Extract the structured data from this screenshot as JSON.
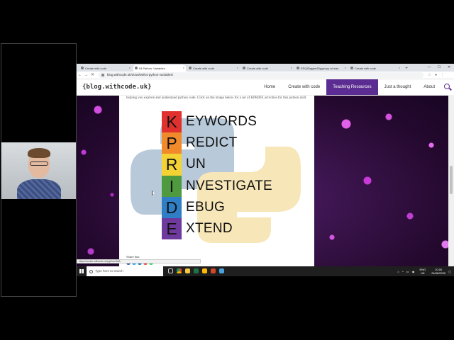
{
  "browser": {
    "tabs": [
      {
        "label": "Create with code",
        "active": false
      },
      {
        "label": "04 Python: Variables",
        "active": true
      },
      {
        "label": "Create with code",
        "active": false
      },
      {
        "label": "Create with code",
        "active": false
      },
      {
        "label": "EPQ/Diggen/Digger.py at mas",
        "active": false
      },
      {
        "label": "Create with code",
        "active": false
      }
    ],
    "url": "blog.withcode.uk/2018/08/04-python-variables/",
    "status_url": "https://create.withcode.uk/python/A8A"
  },
  "site": {
    "logo": "{blog.withcode.uk}",
    "nav": [
      {
        "label": "Home",
        "active": false
      },
      {
        "label": "Create with code",
        "active": false
      },
      {
        "label": "Teaching Resources",
        "active": true
      },
      {
        "label": "Just a thought",
        "active": false
      },
      {
        "label": "About",
        "active": false
      }
    ],
    "intro_text": "helping you explore and understand python code. Click on the image below for a set of KPRIDE activities for this python skill.",
    "share_label": "Share this:"
  },
  "kpride": {
    "rows": [
      {
        "letter": "K",
        "word": "EYWORDS",
        "color": "#e0312f"
      },
      {
        "letter": "P",
        "word": "REDICT",
        "color": "#f08a2a"
      },
      {
        "letter": "R",
        "word": "UN",
        "color": "#f4d234"
      },
      {
        "letter": "I",
        "word": "NVESTIGATE",
        "color": "#4f9a3f"
      },
      {
        "letter": "D",
        "word": "EBUG",
        "color": "#2f7fc6"
      },
      {
        "letter": "E",
        "word": "XTEND",
        "color": "#6f3a9e"
      }
    ]
  },
  "taskbar": {
    "search_placeholder": "Type here to search",
    "lang": "ENG",
    "region": "UK",
    "time": "10:00",
    "date": "24/06/2020"
  },
  "colors": {
    "accent": "#5b2c91",
    "python_blue": "#b8c9d9",
    "python_yellow": "#f7e6b7"
  }
}
